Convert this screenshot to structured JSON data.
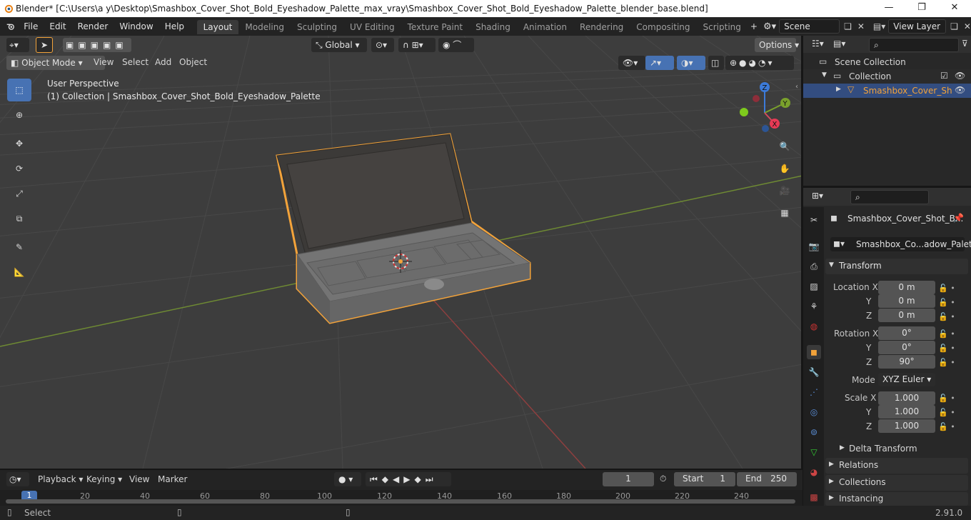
{
  "titlebar": {
    "title": "Blender* [C:\\Users\\a y\\Desktop\\Smashbox_Cover_Shot_Bold_Eyeshadow_Palette_max_vray\\Smashbox_Cover_Shot_Bold_Eyeshadow_Palette_blender_base.blend]",
    "minimize": "—",
    "maximize": "❐",
    "close": "✕"
  },
  "menubar": {
    "menus": [
      "File",
      "Edit",
      "Render",
      "Window",
      "Help"
    ],
    "workspaces": [
      "Layout",
      "Modeling",
      "Sculpting",
      "UV Editing",
      "Texture Paint",
      "Shading",
      "Animation",
      "Rendering",
      "Compositing",
      "Scripting"
    ],
    "add_workspace": "+",
    "scene_label": "Scene",
    "view_layer_label": "View Layer"
  },
  "viewport_header": {
    "mode": "Object Mode",
    "menus": [
      "View",
      "Select",
      "Add",
      "Object"
    ],
    "orientation": "Global",
    "options": "Options"
  },
  "viewport": {
    "perspective_label": "User Perspective",
    "collection_label": "(1) Collection | Smashbox_Cover_Shot_Bold_Eyeshadow_Palette",
    "gizmo": {
      "x": "X",
      "y": "Y",
      "z": "Z"
    }
  },
  "outliner": {
    "scene_collection": "Scene Collection",
    "collection": "Collection",
    "object": "Smashbox_Cover_Sh"
  },
  "properties": {
    "object_name": "Smashbox_Cover_Shot_B...",
    "data_name": "Smashbox_Co...adow_Palette",
    "transform_header": "Transform",
    "location_label": "Location X",
    "rotation_label": "Rotation X",
    "scale_label": "Scale X",
    "y": "Y",
    "z": "Z",
    "location": [
      "0 m",
      "0 m",
      "0 m"
    ],
    "rotation": [
      "0°",
      "0°",
      "90°"
    ],
    "scale": [
      "1.000",
      "1.000",
      "1.000"
    ],
    "mode_label": "Mode",
    "mode_value": "XYZ Euler",
    "delta_transform": "Delta Transform",
    "relations": "Relations",
    "collections": "Collections",
    "instancing": "Instancing"
  },
  "timeline": {
    "menus": [
      "Playback",
      "Keying",
      "View",
      "Marker"
    ],
    "current_frame": "1",
    "start_label": "Start",
    "start_value": "1",
    "end_label": "End",
    "end_value": "250",
    "ruler": [
      "1",
      "20",
      "40",
      "60",
      "80",
      "100",
      "120",
      "140",
      "160",
      "180",
      "200",
      "220",
      "240"
    ]
  },
  "statusbar": {
    "select": "Select",
    "version": "2.91.0"
  },
  "colors": {
    "accent": "#4772b3",
    "selection_outline": "#f3a33a",
    "viewport_bg": "#3d3d3d",
    "panel_bg": "#282828"
  }
}
